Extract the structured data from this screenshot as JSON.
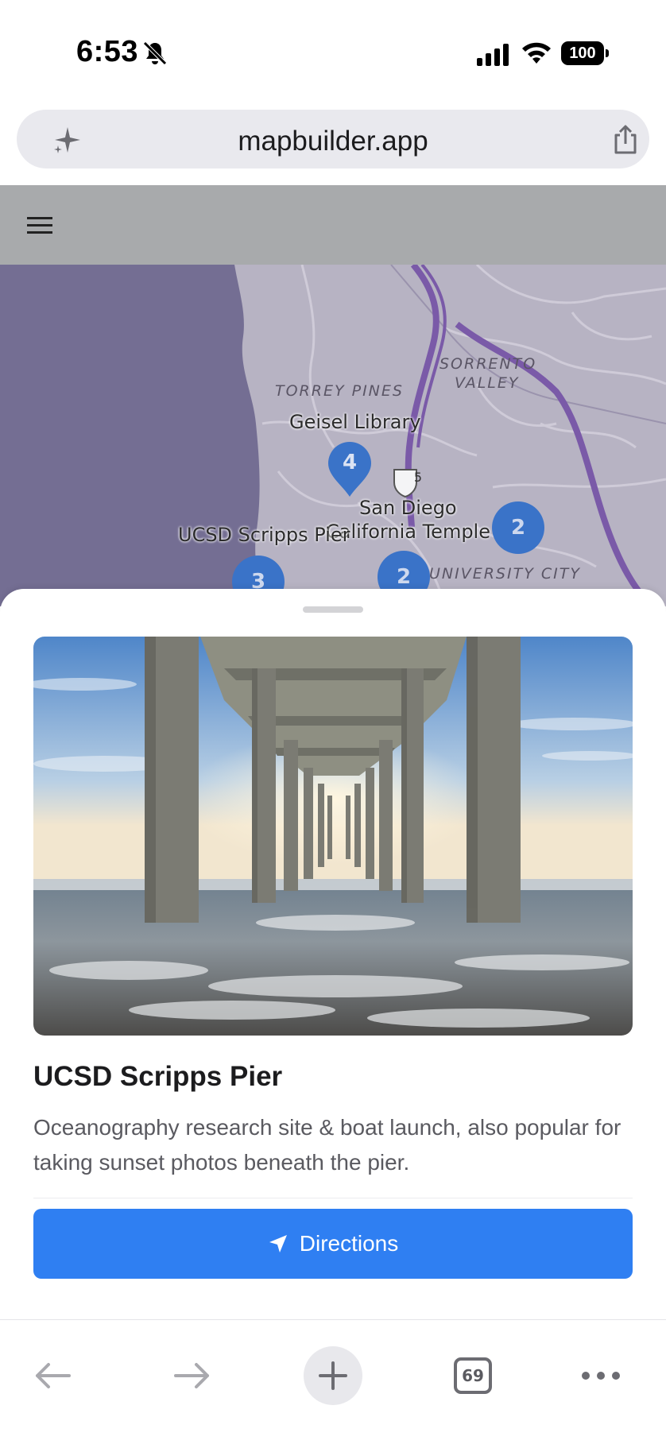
{
  "status_bar": {
    "time": "6:53",
    "battery": "100",
    "icons": [
      "bell-slash-icon",
      "cellular-signal-icon",
      "wifi-icon",
      "battery-icon"
    ]
  },
  "browser": {
    "url": "mapbuilder.app",
    "icons": [
      "sparkle-icon",
      "share-icon"
    ],
    "tab_count": "69",
    "toolbar_icons": [
      "back-arrow-icon",
      "forward-arrow-icon",
      "plus-icon",
      "tabs-icon",
      "more-icon"
    ]
  },
  "app": {
    "menu_icon": "hamburger-menu-icon"
  },
  "map": {
    "area_labels": [
      "TORREY PINES",
      "SORRENTO",
      "VALLEY",
      "UNIVERSITY CITY"
    ],
    "poi_labels": [
      "Geisel Library",
      "San Diego",
      "California Temple",
      "UCSD Scripps Pier"
    ],
    "highway_shield": "5",
    "markers": [
      {
        "label": "4",
        "kind": "pin"
      },
      {
        "label": "2",
        "kind": "cluster"
      },
      {
        "label": "2",
        "kind": "cluster"
      },
      {
        "label": "3",
        "kind": "cluster"
      }
    ],
    "colors": {
      "ocean": "#746e93",
      "land": "#b7b3c3",
      "highway": "#7a5aa8",
      "marker": "#3a73c8"
    }
  },
  "sheet": {
    "image_alt": "Under-pier view of Scripps Pier at sunset",
    "title": "UCSD Scripps Pier",
    "description": "Oceanography research site & boat launch, also popular for taking sunset photos beneath the pier.",
    "directions_label": "Directions",
    "accent": "#2f7ff2"
  }
}
